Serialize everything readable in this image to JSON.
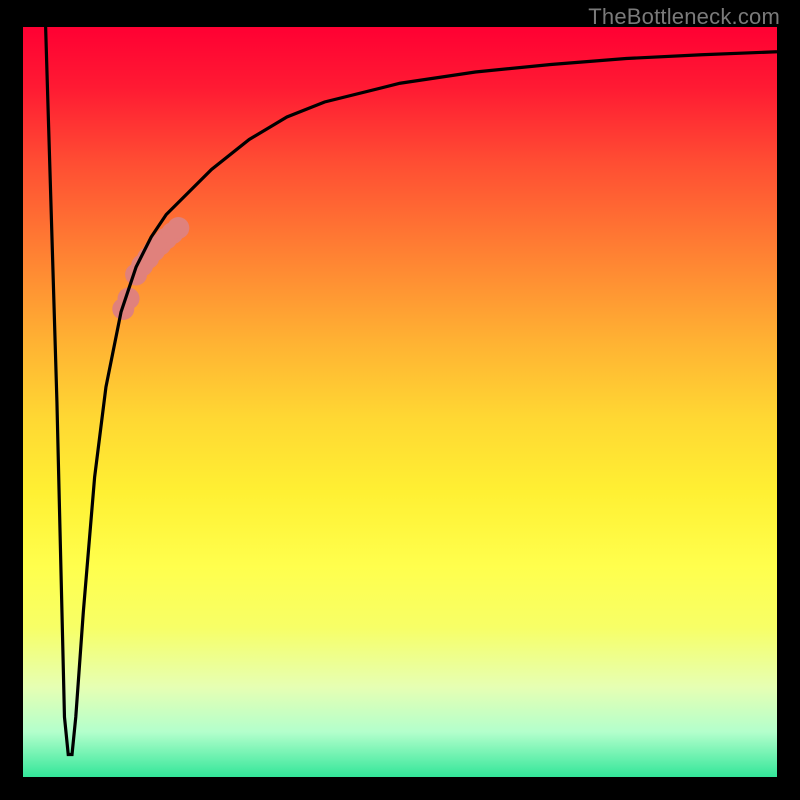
{
  "watermark": "TheBottleneck.com",
  "chart_data": {
    "type": "line",
    "title": "",
    "xlabel": "",
    "ylabel": "",
    "xlim": [
      0,
      100
    ],
    "ylim": [
      0,
      100
    ],
    "background_gradient_note": "vertical heat gradient from red (top) through orange/yellow to green (bottom)",
    "series": [
      {
        "name": "bottleneck-curve",
        "color": "#000000",
        "x": [
          3,
          4.5,
          5.5,
          6,
          6.5,
          7,
          8,
          9.5,
          11,
          13,
          15,
          17,
          19,
          22,
          25,
          30,
          35,
          40,
          50,
          60,
          70,
          80,
          90,
          100
        ],
        "y": [
          100,
          50,
          8,
          3,
          3,
          8,
          22,
          40,
          52,
          62,
          68,
          72,
          75,
          78,
          81,
          85,
          88,
          90,
          92.5,
          94,
          95,
          95.8,
          96.3,
          96.7
        ]
      }
    ],
    "highlight_points": {
      "name": "highlighted-segment",
      "color": "#e0817c",
      "radius_px": 11,
      "points_xy": [
        [
          15.0,
          67.0
        ],
        [
          15.8,
          68.2
        ],
        [
          16.6,
          69.2
        ],
        [
          17.4,
          70.2
        ],
        [
          18.2,
          71.0
        ],
        [
          19.0,
          71.8
        ],
        [
          19.8,
          72.5
        ],
        [
          20.6,
          73.2
        ],
        [
          14.0,
          63.8
        ],
        [
          13.3,
          62.4
        ]
      ]
    }
  }
}
